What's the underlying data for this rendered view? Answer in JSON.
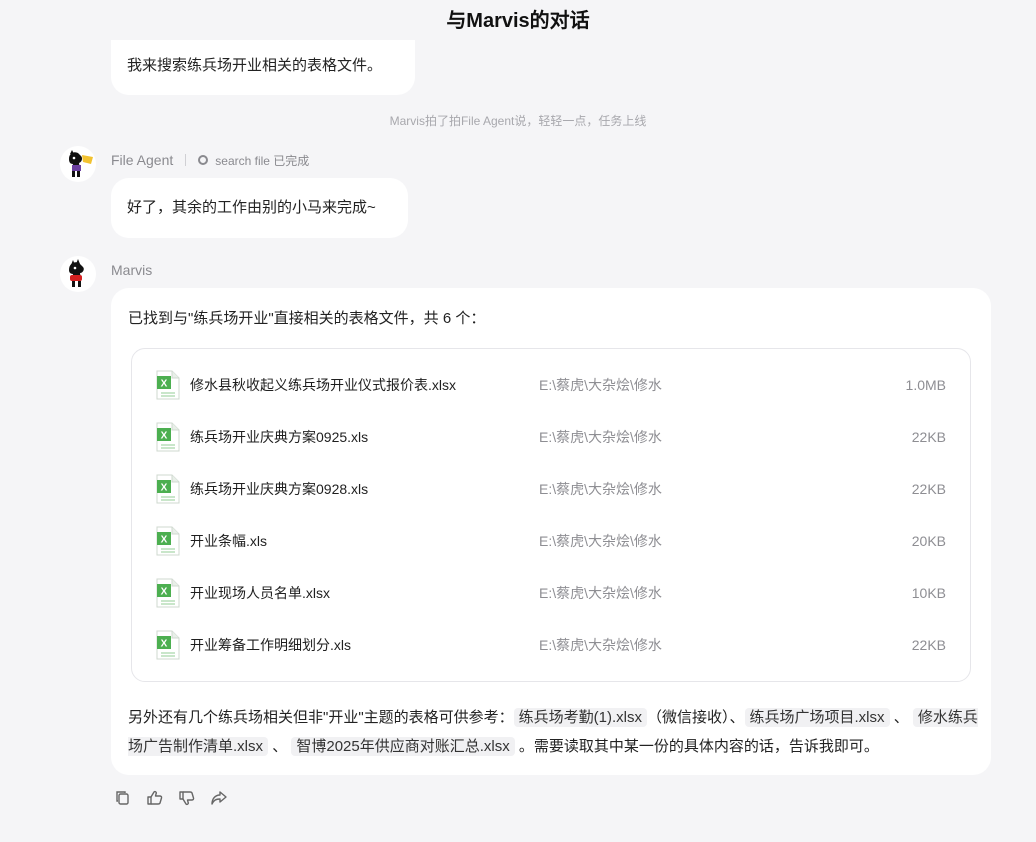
{
  "header": {
    "title": "与Marvis的对话"
  },
  "messages": {
    "marvis_prev": {
      "text": "我来搜索练兵场开业相关的表格文件。"
    },
    "system_note": "Marvis拍了拍File Agent说，轻轻一点，任务上线",
    "file_agent": {
      "sender": "File Agent",
      "status": "search file 已完成",
      "text": "好了，其余的工作由别的小马来完成~"
    },
    "marvis": {
      "sender": "Marvis",
      "intro": "已找到与\"练兵场开业\"直接相关的表格文件，共 6 个：",
      "files": [
        {
          "name": "修水县秋收起义练兵场开业仪式报价表.xlsx",
          "path": "E:\\蔡虎\\大杂烩\\修水",
          "size": "1.0MB"
        },
        {
          "name": "练兵场开业庆典方案0925.xls",
          "path": "E:\\蔡虎\\大杂烩\\修水",
          "size": "22KB"
        },
        {
          "name": "练兵场开业庆典方案0928.xls",
          "path": "E:\\蔡虎\\大杂烩\\修水",
          "size": "22KB"
        },
        {
          "name": "开业条幅.xls",
          "path": "E:\\蔡虎\\大杂烩\\修水",
          "size": "20KB"
        },
        {
          "name": "开业现场人员名单.xlsx",
          "path": "E:\\蔡虎\\大杂烩\\修水",
          "size": "10KB"
        },
        {
          "name": "开业筹备工作明细划分.xls",
          "path": "E:\\蔡虎\\大杂烩\\修水",
          "size": "22KB"
        }
      ],
      "footer": {
        "t1": "另外还有几个练兵场相关但非\"开业\"主题的表格可供参考：",
        "c1": "练兵场考勤(1).xlsx",
        "t2": "（微信接收）、",
        "c2": "练兵场广场项目.xlsx",
        "t3": "、",
        "c3": "修水练兵场广告制作清单.xlsx",
        "t4": "、",
        "c4": "智博2025年供应商对账汇总.xlsx",
        "t5": "。需要读取其中某一份的具体内容的话，告诉我即可。"
      }
    }
  },
  "icons": {
    "copy": "copy-icon",
    "like": "thumbs-up-icon",
    "dislike": "thumbs-down-icon",
    "share": "share-icon",
    "file": "excel-file-icon"
  },
  "colors": {
    "excel_green": "#4caf50",
    "background": "#f5f5f7",
    "bubble": "#ffffff"
  }
}
